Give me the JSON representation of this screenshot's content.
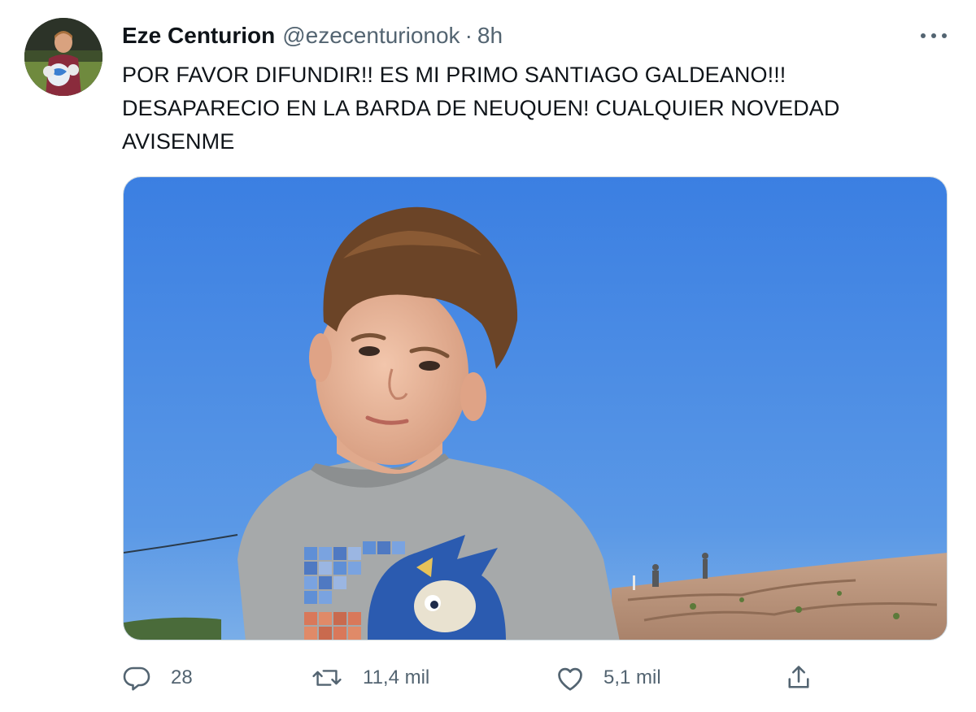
{
  "tweet": {
    "author_name": "Eze Centurion",
    "author_handle": "@ezecenturionok",
    "separator": "·",
    "time": "8h",
    "text_lines": [
      "POR FAVOR DIFUNDIR!! ES MI PRIMO SANTIAGO GALDEANO!!!",
      "DESAPARECIO EN LA BARDA DE NEUQUEN! CUALQUIER NOVEDAD",
      "AVISENME"
    ]
  },
  "actions": {
    "reply": {
      "icon": "reply-icon",
      "count": "28"
    },
    "retweet": {
      "icon": "retweet-icon",
      "count": "11,4 mil"
    },
    "like": {
      "icon": "heart-icon",
      "count": "5,1 mil"
    },
    "share": {
      "icon": "share-icon"
    }
  },
  "colors": {
    "text_primary": "#0f1419",
    "text_secondary": "#536471",
    "sky": "#3f86e6"
  }
}
